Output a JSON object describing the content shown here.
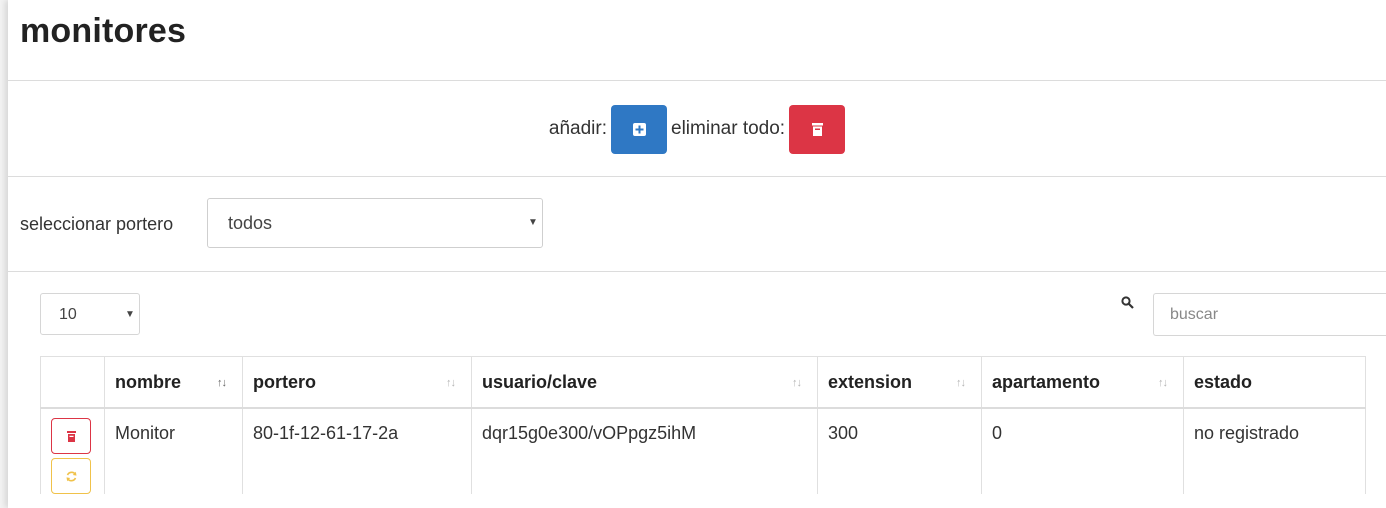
{
  "page": {
    "title": "monitores"
  },
  "actions": {
    "add_label": "añadir:",
    "delete_all_label": "eliminar todo:"
  },
  "filter": {
    "portero_label": "seleccionar portero",
    "portero_selected": "todos"
  },
  "table_controls": {
    "page_length": "10",
    "search_placeholder": "buscar"
  },
  "table": {
    "columns": [
      "",
      "nombre",
      "portero",
      "usuario/clave",
      "extension",
      "apartamento",
      "estado"
    ],
    "rows": [
      {
        "nombre": "Monitor",
        "portero": "80-1f-12-61-17-2a",
        "usuario_clave": "dqr15g0e300/vOPpgz5ihM",
        "extension": "300",
        "apartamento": "0",
        "estado": "no registrado"
      }
    ]
  },
  "colors": {
    "primary": "#2f78c4",
    "danger": "#dc3545",
    "warning": "#f0c24a",
    "status_text": "#d9534f"
  }
}
